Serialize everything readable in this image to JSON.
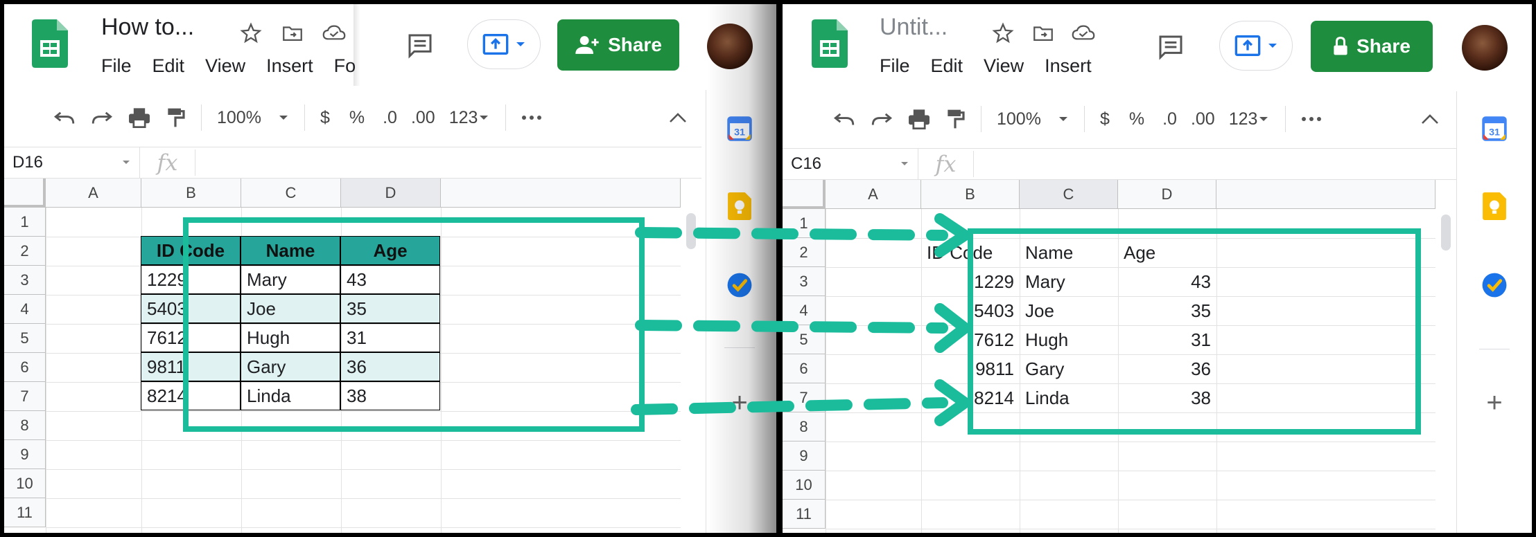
{
  "left": {
    "doc_title": "How to...",
    "menu": [
      "File",
      "Edit",
      "View",
      "Insert",
      "Fo"
    ],
    "share_label": "Share",
    "zoom": "100%",
    "currency": "$",
    "percent": "%",
    "dec_less": ".0",
    "dec_more": ".00",
    "format_more": "123",
    "namebox": "D16",
    "fx": "fx",
    "columns": [
      "A",
      "B",
      "C",
      "D"
    ],
    "rows": [
      "1",
      "2",
      "3",
      "4",
      "5",
      "6",
      "7",
      "8",
      "9",
      "10",
      "11"
    ],
    "table_headers": [
      "ID Code",
      "Name",
      "Age"
    ],
    "table_rows": [
      [
        "1229",
        "Mary",
        "43"
      ],
      [
        "5403",
        "Joe",
        "35"
      ],
      [
        "7612",
        "Hugh",
        "31"
      ],
      [
        "9811",
        "Gary",
        "36"
      ],
      [
        "8214",
        "Linda",
        "38"
      ]
    ],
    "calendar_day": "31"
  },
  "right": {
    "doc_title": "Untit...",
    "menu": [
      "File",
      "Edit",
      "View",
      "Insert"
    ],
    "share_label": "Share",
    "zoom": "100%",
    "currency": "$",
    "percent": "%",
    "dec_less": ".0",
    "dec_more": ".00",
    "format_more": "123",
    "namebox": "C16",
    "fx": "fx",
    "columns": [
      "A",
      "B",
      "C",
      "D"
    ],
    "rows": [
      "1",
      "2",
      "3",
      "4",
      "5",
      "6",
      "7",
      "8",
      "9",
      "10",
      "11"
    ],
    "table_headers": [
      "ID Code",
      "Name",
      "Age"
    ],
    "table_rows": [
      [
        "1229",
        "Mary",
        "43"
      ],
      [
        "5403",
        "Joe",
        "35"
      ],
      [
        "7612",
        "Hugh",
        "31"
      ],
      [
        "9811",
        "Gary",
        "36"
      ],
      [
        "8214",
        "Linda",
        "38"
      ]
    ],
    "calendar_day": "31"
  },
  "icons": {
    "undo": "undo-icon",
    "redo": "redo-icon",
    "print": "print-icon",
    "paint": "paint-format-icon",
    "more": "more-horiz-icon",
    "collapse": "chevron-up-icon",
    "comment": "comment-icon",
    "star": "star-icon",
    "move": "move-to-folder-icon",
    "cloud": "cloud-saved-icon",
    "present": "present-icon",
    "share_left": "person-add-icon",
    "share_right": "lock-icon",
    "calendar": "calendar-icon",
    "keep": "keep-icon",
    "tasks": "tasks-icon",
    "add": "plus-icon"
  },
  "colors": {
    "share_green": "#1e8e3e",
    "table_header": "#26a69a",
    "table_alt": "#e0f2f1",
    "highlight_teal": "#1abc9c"
  }
}
